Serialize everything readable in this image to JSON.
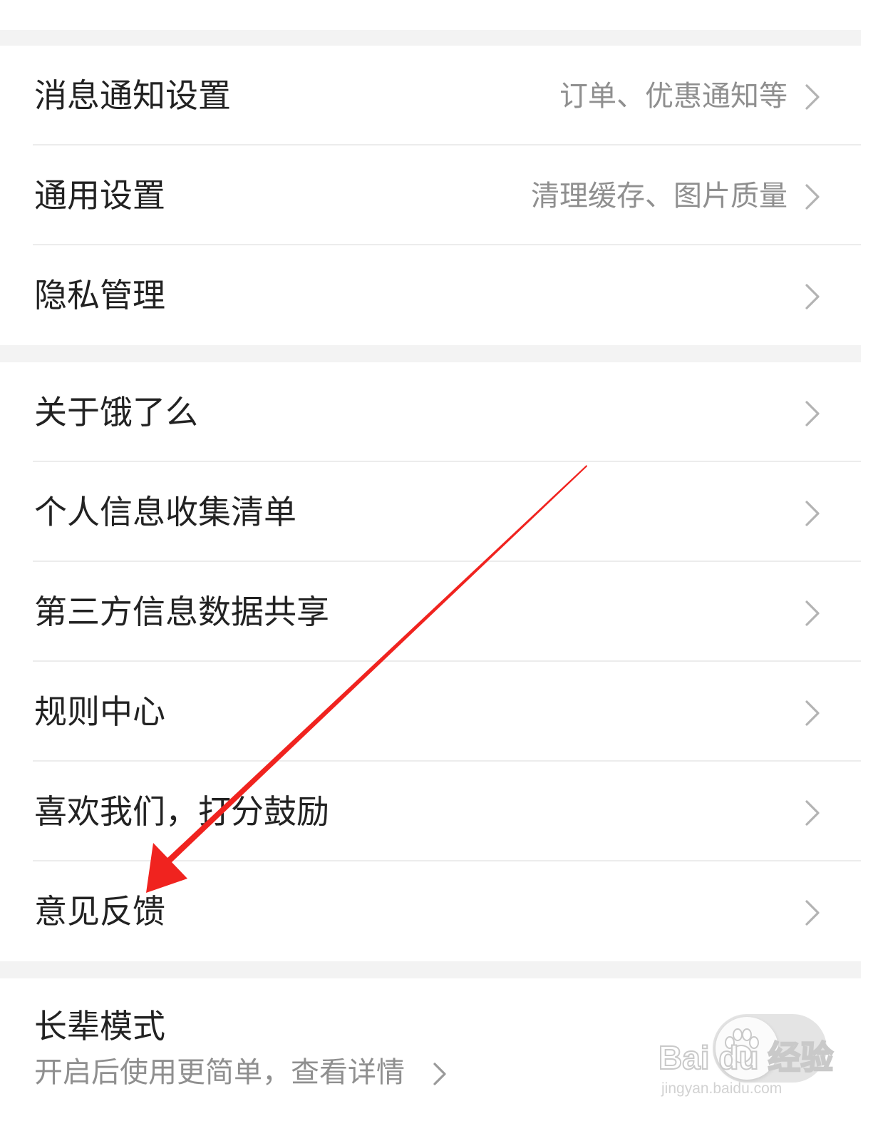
{
  "settings": {
    "group1": [
      {
        "label": "消息通知设置",
        "hint": "订单、优惠通知等"
      },
      {
        "label": "通用设置",
        "hint": "清理缓存、图片质量"
      },
      {
        "label": "隐私管理",
        "hint": ""
      }
    ],
    "group2": [
      {
        "label": "关于饿了么"
      },
      {
        "label": "个人信息收集清单"
      },
      {
        "label": "第三方信息数据共享"
      },
      {
        "label": "规则中心"
      },
      {
        "label": "喜欢我们，打分鼓励"
      },
      {
        "label": "意见反馈"
      }
    ],
    "elder_mode": {
      "title": "长辈模式",
      "subtitle": "开启后使用更简单，查看详情",
      "toggle_on": false
    }
  },
  "icons": {
    "row_chevron": "chevron-right-icon"
  },
  "annotation": {
    "arrow_color": "#f0231f"
  },
  "watermark": {
    "logo": "Bai du 经验",
    "url": "jingyan.baidu.com"
  },
  "colors": {
    "section_gap": "#f3f3f3",
    "divider": "#ececec",
    "label_text": "#222222",
    "hint_text": "#8f8f8f",
    "chevron": "#b3b3b3"
  }
}
